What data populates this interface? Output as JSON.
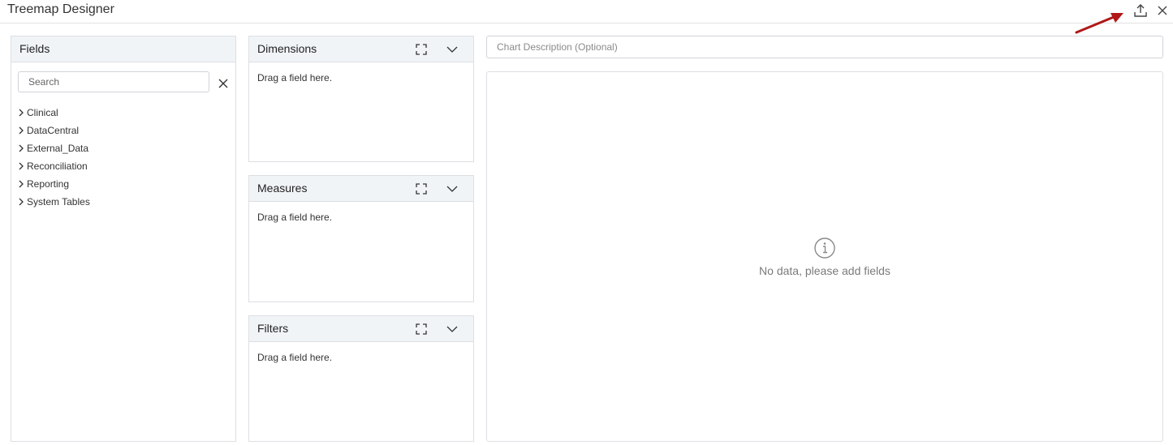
{
  "window": {
    "title": "Treemap Designer"
  },
  "fields_panel": {
    "title": "Fields",
    "search_placeholder": "Search",
    "items": [
      {
        "label": "Clinical"
      },
      {
        "label": "DataCentral"
      },
      {
        "label": "External_Data"
      },
      {
        "label": "Reconciliation"
      },
      {
        "label": "Reporting"
      },
      {
        "label": "System Tables"
      }
    ]
  },
  "zones": {
    "dimensions": {
      "title": "Dimensions",
      "placeholder": "Drag a field here."
    },
    "measures": {
      "title": "Measures",
      "placeholder": "Drag a field here."
    },
    "filters": {
      "title": "Filters",
      "placeholder": "Drag a field here."
    }
  },
  "chart": {
    "description_placeholder": "Chart Description (Optional)",
    "empty_message": "No data, please add fields"
  },
  "colors": {
    "annotation_arrow": "#b01818",
    "header_bg": "#f1f4f7",
    "border": "#dcdfe3"
  },
  "icons": [
    "export-icon",
    "close-icon",
    "clear-search-icon",
    "chevron-right-icon",
    "expand-icon",
    "chevron-down-icon",
    "info-icon"
  ]
}
